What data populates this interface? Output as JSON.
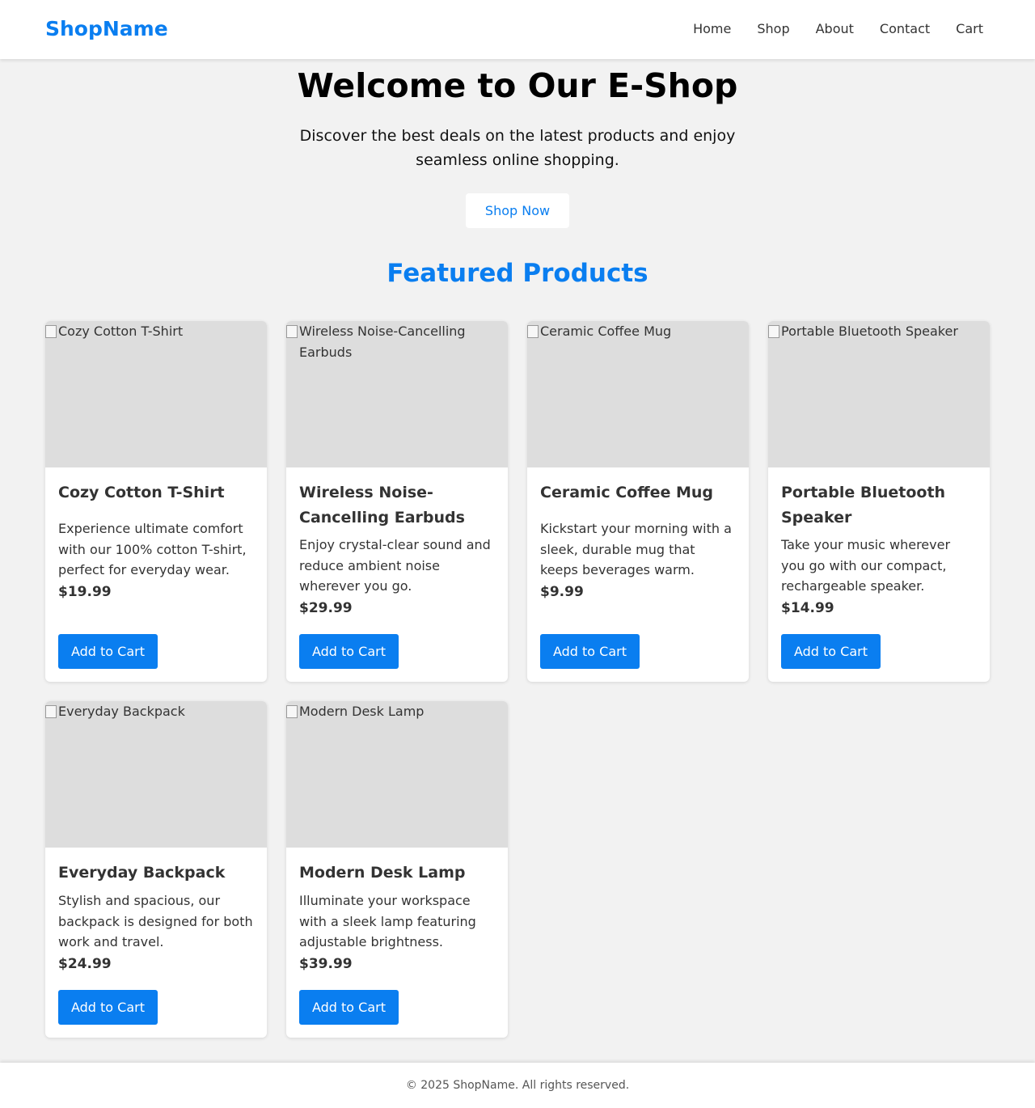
{
  "header": {
    "brand": "ShopName",
    "nav": [
      "Home",
      "Shop",
      "About",
      "Contact",
      "Cart"
    ]
  },
  "hero": {
    "title": "Welcome to Our E-Shop",
    "subtitle": "Discover the best deals on the latest products and enjoy seamless online shopping.",
    "cta": "Shop Now"
  },
  "featured": {
    "title": "Featured Products",
    "products": [
      {
        "image_alt": "Cozy Cotton T-Shirt",
        "name": "Cozy Cotton T-Shirt",
        "description": "Experience ultimate comfort with our 100% cotton T-shirt, perfect for everyday wear.",
        "price": "$19.99",
        "button": "Add to Cart"
      },
      {
        "image_alt": "Wireless Noise-Cancelling Earbuds",
        "name": "Wireless Noise-Cancelling Earbuds",
        "description": "Enjoy crystal-clear sound and reduce ambient noise wherever you go.",
        "price": "$29.99",
        "button": "Add to Cart"
      },
      {
        "image_alt": "Ceramic Coffee Mug",
        "name": "Ceramic Coffee Mug",
        "description": "Kickstart your morning with a sleek, durable mug that keeps beverages warm.",
        "price": "$9.99",
        "button": "Add to Cart"
      },
      {
        "image_alt": "Portable Bluetooth Speaker",
        "name": "Portable Bluetooth Speaker",
        "description": "Take your music wherever you go with our compact, rechargeable speaker.",
        "price": "$14.99",
        "button": "Add to Cart"
      },
      {
        "image_alt": "Everyday Backpack",
        "name": "Everyday Backpack",
        "description": "Stylish and spacious, our backpack is designed for both work and travel.",
        "price": "$24.99",
        "button": "Add to Cart"
      },
      {
        "image_alt": "Modern Desk Lamp",
        "name": "Modern Desk Lamp",
        "description": "Illuminate your workspace with a sleek lamp featuring adjustable brightness.",
        "price": "$39.99",
        "button": "Add to Cart"
      }
    ]
  },
  "footer": {
    "text": "© 2025 ShopName. All rights reserved."
  },
  "colors": {
    "accent": "#0a7ef0",
    "background": "#f2f2f2",
    "image_placeholder": "#dddddd"
  }
}
